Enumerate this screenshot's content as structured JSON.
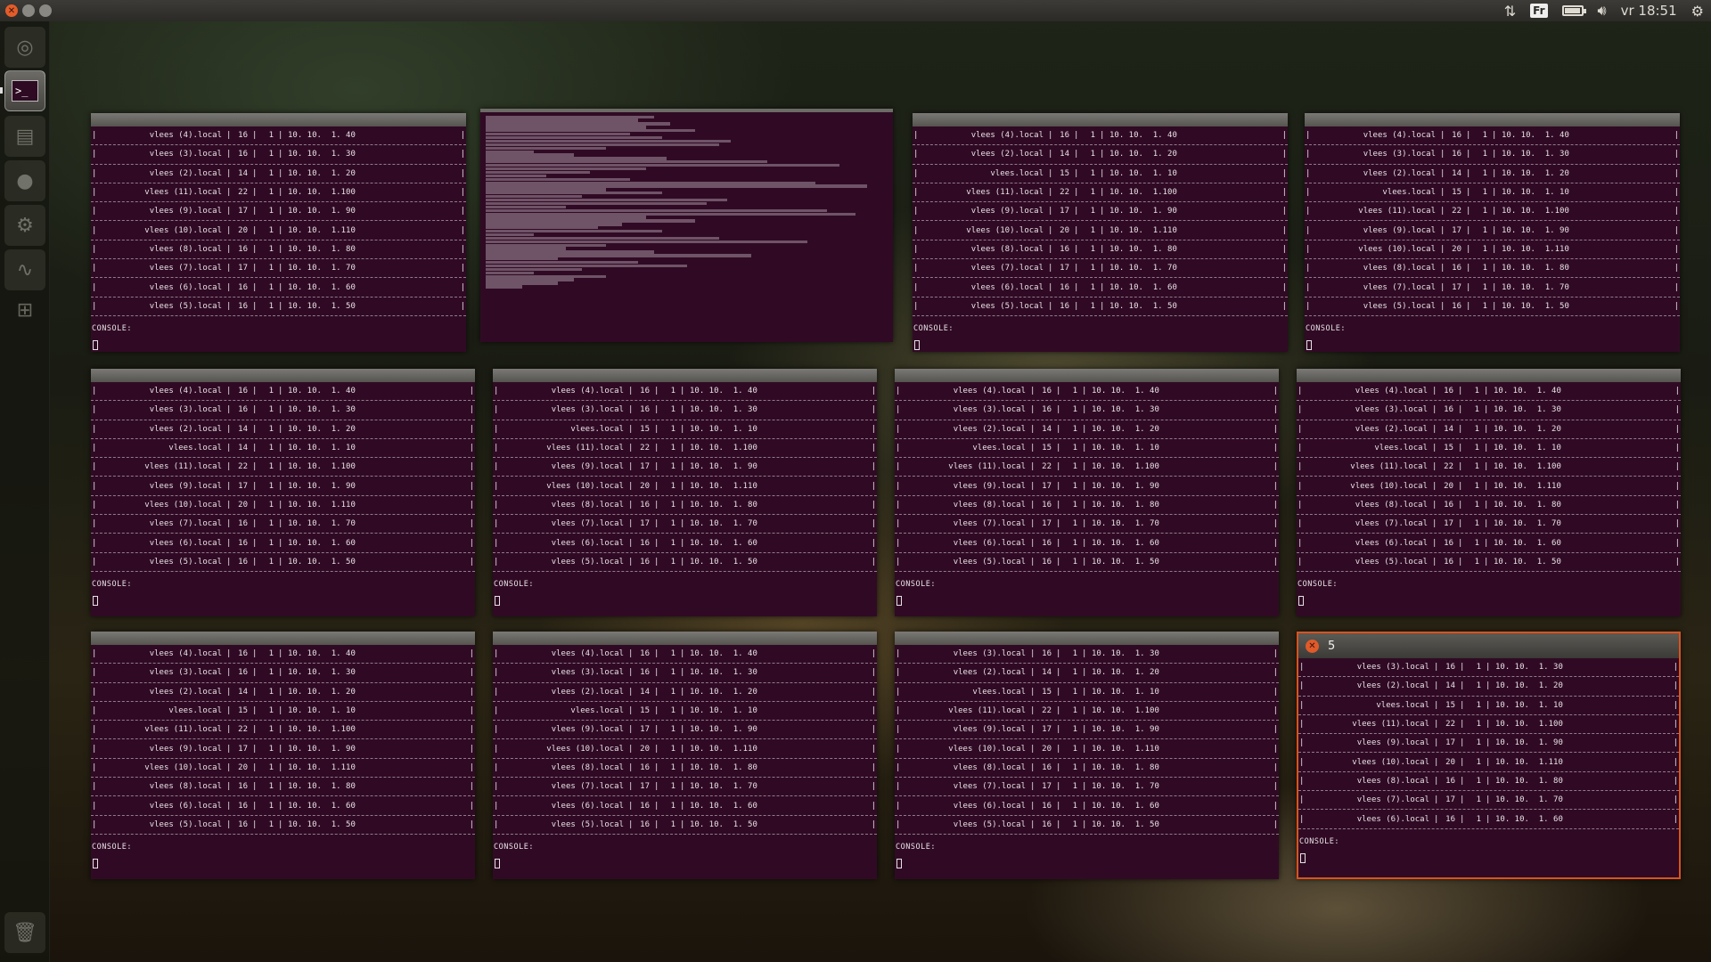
{
  "panel": {
    "clock": "vr 18:51",
    "keyboard_layout": "Fr",
    "battery_level": 0.85
  },
  "launcher": {
    "items": [
      "dash-icon",
      "terminal-icon",
      "files-icon",
      "browser-icon",
      "settings-icon",
      "system-monitor-icon",
      "workspaces-icon",
      "trash-icon"
    ],
    "active": "terminal-icon"
  },
  "windows": [
    {
      "rows": [
        [
          "vlees (4).local",
          "16",
          "1",
          "10. 10.  1. 40"
        ],
        [
          "vlees (3).local",
          "16",
          "1",
          "10. 10.  1. 30"
        ],
        [
          "vlees (2).local",
          "14",
          "1",
          "10. 10.  1. 20"
        ],
        [
          "vlees (11).local",
          "22",
          "1",
          "10. 10.  1.100"
        ],
        [
          "vlees (9).local",
          "17",
          "1",
          "10. 10.  1. 90"
        ],
        [
          "vlees (10).local",
          "20",
          "1",
          "10. 10.  1.110"
        ],
        [
          "vlees (8).local",
          "16",
          "1",
          "10. 10.  1. 80"
        ],
        [
          "vlees (7).local",
          "17",
          "1",
          "10. 10.  1. 70"
        ],
        [
          "vlees (6).local",
          "16",
          "1",
          "10. 10.  1. 60"
        ],
        [
          "vlees (5).local",
          "16",
          "1",
          "10. 10.  1. 50"
        ]
      ],
      "console": "CONSOLE:"
    },
    {
      "log": true
    },
    {
      "rows": [
        [
          "vlees (4).local",
          "16",
          "1",
          "10. 10.  1. 40"
        ],
        [
          "vlees (2).local",
          "14",
          "1",
          "10. 10.  1. 20"
        ],
        [
          "vlees.local",
          "15",
          "1",
          "10. 10.  1. 10"
        ],
        [
          "vlees (11).local",
          "22",
          "1",
          "10. 10.  1.100"
        ],
        [
          "vlees (9).local",
          "17",
          "1",
          "10. 10.  1. 90"
        ],
        [
          "vlees (10).local",
          "20",
          "1",
          "10. 10.  1.110"
        ],
        [
          "vlees (8).local",
          "16",
          "1",
          "10. 10.  1. 80"
        ],
        [
          "vlees (7).local",
          "17",
          "1",
          "10. 10.  1. 70"
        ],
        [
          "vlees (6).local",
          "16",
          "1",
          "10. 10.  1. 60"
        ],
        [
          "vlees (5).local",
          "16",
          "1",
          "10. 10.  1. 50"
        ]
      ],
      "console": "CONSOLE:"
    },
    {
      "rows": [
        [
          "vlees (4).local",
          "16",
          "1",
          "10. 10.  1. 40"
        ],
        [
          "vlees (3).local",
          "16",
          "1",
          "10. 10.  1. 30"
        ],
        [
          "vlees (2).local",
          "14",
          "1",
          "10. 10.  1. 20"
        ],
        [
          "vlees.local",
          "15",
          "1",
          "10. 10.  1. 10"
        ],
        [
          "vlees (11).local",
          "22",
          "1",
          "10. 10.  1.100"
        ],
        [
          "vlees (9).local",
          "17",
          "1",
          "10. 10.  1. 90"
        ],
        [
          "vlees (10).local",
          "20",
          "1",
          "10. 10.  1.110"
        ],
        [
          "vlees (8).local",
          "16",
          "1",
          "10. 10.  1. 80"
        ],
        [
          "vlees (7).local",
          "17",
          "1",
          "10. 10.  1. 70"
        ],
        [
          "vlees (5).local",
          "16",
          "1",
          "10. 10.  1. 50"
        ]
      ],
      "console": "CONSOLE:"
    },
    {
      "rows": [
        [
          "vlees (4).local",
          "16",
          "1",
          "10. 10.  1. 40"
        ],
        [
          "vlees (3).local",
          "16",
          "1",
          "10. 10.  1. 30"
        ],
        [
          "vlees (2).local",
          "14",
          "1",
          "10. 10.  1. 20"
        ],
        [
          "vlees.local",
          "14",
          "1",
          "10. 10.  1. 10"
        ],
        [
          "vlees (11).local",
          "22",
          "1",
          "10. 10.  1.100"
        ],
        [
          "vlees (9).local",
          "17",
          "1",
          "10. 10.  1. 90"
        ],
        [
          "vlees (10).local",
          "20",
          "1",
          "10. 10.  1.110"
        ],
        [
          "vlees (7).local",
          "16",
          "1",
          "10. 10.  1. 70"
        ],
        [
          "vlees (6).local",
          "16",
          "1",
          "10. 10.  1. 60"
        ],
        [
          "vlees (5).local",
          "16",
          "1",
          "10. 10.  1. 50"
        ]
      ],
      "console": "CONSOLE:"
    },
    {
      "rows": [
        [
          "vlees (4).local",
          "16",
          "1",
          "10. 10.  1. 40"
        ],
        [
          "vlees (3).local",
          "16",
          "1",
          "10. 10.  1. 30"
        ],
        [
          "vlees.local",
          "15",
          "1",
          "10. 10.  1. 10"
        ],
        [
          "vlees (11).local",
          "22",
          "1",
          "10. 10.  1.100"
        ],
        [
          "vlees (9).local",
          "17",
          "1",
          "10. 10.  1. 90"
        ],
        [
          "vlees (10).local",
          "20",
          "1",
          "10. 10.  1.110"
        ],
        [
          "vlees (8).local",
          "16",
          "1",
          "10. 10.  1. 80"
        ],
        [
          "vlees (7).local",
          "17",
          "1",
          "10. 10.  1. 70"
        ],
        [
          "vlees (6).local",
          "16",
          "1",
          "10. 10.  1. 60"
        ],
        [
          "vlees (5).local",
          "16",
          "1",
          "10. 10.  1. 50"
        ]
      ],
      "console": "CONSOLE:"
    },
    {
      "rows": [
        [
          "vlees (4).local",
          "16",
          "1",
          "10. 10.  1. 40"
        ],
        [
          "vlees (3).local",
          "16",
          "1",
          "10. 10.  1. 30"
        ],
        [
          "vlees (2).local",
          "14",
          "1",
          "10. 10.  1. 20"
        ],
        [
          "vlees.local",
          "15",
          "1",
          "10. 10.  1. 10"
        ],
        [
          "vlees (11).local",
          "22",
          "1",
          "10. 10.  1.100"
        ],
        [
          "vlees (9).local",
          "17",
          "1",
          "10. 10.  1. 90"
        ],
        [
          "vlees (8).local",
          "16",
          "1",
          "10. 10.  1. 80"
        ],
        [
          "vlees (7).local",
          "17",
          "1",
          "10. 10.  1. 70"
        ],
        [
          "vlees (6).local",
          "16",
          "1",
          "10. 10.  1. 60"
        ],
        [
          "vlees (5).local",
          "16",
          "1",
          "10. 10.  1. 50"
        ]
      ],
      "console": "CONSOLE:"
    },
    {
      "rows": [
        [
          "vlees (4).local",
          "16",
          "1",
          "10. 10.  1. 40"
        ],
        [
          "vlees (3).local",
          "16",
          "1",
          "10. 10.  1. 30"
        ],
        [
          "vlees (2).local",
          "14",
          "1",
          "10. 10.  1. 20"
        ],
        [
          "vlees.local",
          "15",
          "1",
          "10. 10.  1. 10"
        ],
        [
          "vlees (11).local",
          "22",
          "1",
          "10. 10.  1.100"
        ],
        [
          "vlees (10).local",
          "20",
          "1",
          "10. 10.  1.110"
        ],
        [
          "vlees (8).local",
          "16",
          "1",
          "10. 10.  1. 80"
        ],
        [
          "vlees (7).local",
          "17",
          "1",
          "10. 10.  1. 70"
        ],
        [
          "vlees (6).local",
          "16",
          "1",
          "10. 10.  1. 60"
        ],
        [
          "vlees (5).local",
          "16",
          "1",
          "10. 10.  1. 50"
        ]
      ],
      "console": "CONSOLE:"
    },
    {
      "rows": [
        [
          "vlees (4).local",
          "16",
          "1",
          "10. 10.  1. 40"
        ],
        [
          "vlees (3).local",
          "16",
          "1",
          "10. 10.  1. 30"
        ],
        [
          "vlees (2).local",
          "14",
          "1",
          "10. 10.  1. 20"
        ],
        [
          "vlees.local",
          "15",
          "1",
          "10. 10.  1. 10"
        ],
        [
          "vlees (11).local",
          "22",
          "1",
          "10. 10.  1.100"
        ],
        [
          "vlees (9).local",
          "17",
          "1",
          "10. 10.  1. 90"
        ],
        [
          "vlees (10).local",
          "20",
          "1",
          "10. 10.  1.110"
        ],
        [
          "vlees (8).local",
          "16",
          "1",
          "10. 10.  1. 80"
        ],
        [
          "vlees (6).local",
          "16",
          "1",
          "10. 10.  1. 60"
        ],
        [
          "vlees (5).local",
          "16",
          "1",
          "10. 10.  1. 50"
        ]
      ],
      "console": "CONSOLE:"
    },
    {
      "rows": [
        [
          "vlees (4).local",
          "16",
          "1",
          "10. 10.  1. 40"
        ],
        [
          "vlees (3).local",
          "16",
          "1",
          "10. 10.  1. 30"
        ],
        [
          "vlees (2).local",
          "14",
          "1",
          "10. 10.  1. 20"
        ],
        [
          "vlees.local",
          "15",
          "1",
          "10. 10.  1. 10"
        ],
        [
          "vlees (9).local",
          "17",
          "1",
          "10. 10.  1. 90"
        ],
        [
          "vlees (10).local",
          "20",
          "1",
          "10. 10.  1.110"
        ],
        [
          "vlees (8).local",
          "16",
          "1",
          "10. 10.  1. 80"
        ],
        [
          "vlees (7).local",
          "17",
          "1",
          "10. 10.  1. 70"
        ],
        [
          "vlees (6).local",
          "16",
          "1",
          "10. 10.  1. 60"
        ],
        [
          "vlees (5).local",
          "16",
          "1",
          "10. 10.  1. 50"
        ]
      ],
      "console": "CONSOLE:"
    },
    {
      "rows": [
        [
          "vlees (3).local",
          "16",
          "1",
          "10. 10.  1. 30"
        ],
        [
          "vlees (2).local",
          "14",
          "1",
          "10. 10.  1. 20"
        ],
        [
          "vlees.local",
          "15",
          "1",
          "10. 10.  1. 10"
        ],
        [
          "vlees (11).local",
          "22",
          "1",
          "10. 10.  1.100"
        ],
        [
          "vlees (9).local",
          "17",
          "1",
          "10. 10.  1. 90"
        ],
        [
          "vlees (10).local",
          "20",
          "1",
          "10. 10.  1.110"
        ],
        [
          "vlees (8).local",
          "16",
          "1",
          "10. 10.  1. 80"
        ],
        [
          "vlees (7).local",
          "17",
          "1",
          "10. 10.  1. 70"
        ],
        [
          "vlees (6).local",
          "16",
          "1",
          "10. 10.  1. 60"
        ],
        [
          "vlees (5).local",
          "16",
          "1",
          "10. 10.  1. 50"
        ]
      ],
      "console": "CONSOLE:"
    },
    {
      "rows": [
        [
          "vlees (3).local",
          "16",
          "1",
          "10. 10.  1. 30"
        ],
        [
          "vlees (2).local",
          "14",
          "1",
          "10. 10.  1. 20"
        ],
        [
          "vlees.local",
          "15",
          "1",
          "10. 10.  1. 10"
        ],
        [
          "vlees (11).local",
          "22",
          "1",
          "10. 10.  1.100"
        ],
        [
          "vlees (9).local",
          "17",
          "1",
          "10. 10.  1. 90"
        ],
        [
          "vlees (10).local",
          "20",
          "1",
          "10. 10.  1.110"
        ],
        [
          "vlees (8).local",
          "16",
          "1",
          "10. 10.  1. 80"
        ],
        [
          "vlees (7).local",
          "17",
          "1",
          "10. 10.  1. 70"
        ],
        [
          "vlees (6).local",
          "16",
          "1",
          "10. 10.  1. 60"
        ]
      ],
      "console": "CONSOLE:",
      "focused": true,
      "title": "5"
    }
  ]
}
